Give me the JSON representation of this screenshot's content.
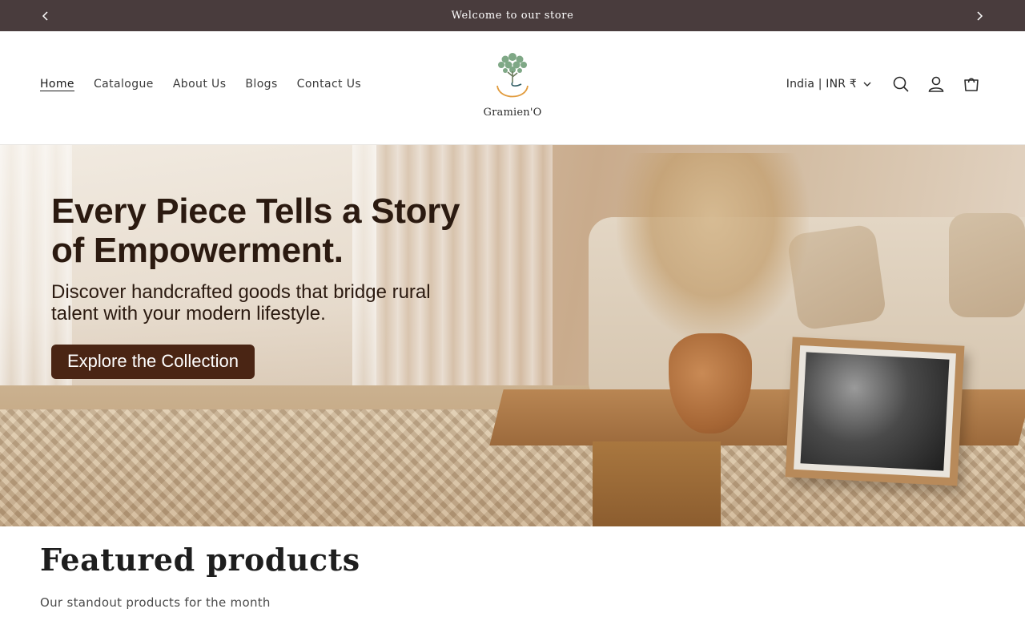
{
  "announcement": {
    "message": "Welcome to our store",
    "prev_icon": "chevron-left-icon",
    "next_icon": "chevron-right-icon"
  },
  "header": {
    "nav": [
      {
        "label": "Home",
        "active": true
      },
      {
        "label": "Catalogue",
        "active": false
      },
      {
        "label": "About Us",
        "active": false
      },
      {
        "label": "Blogs",
        "active": false
      },
      {
        "label": "Contact Us",
        "active": false
      }
    ],
    "logo": {
      "brand": "Gramien'O"
    },
    "country_selector": "India | INR ₹",
    "icons": [
      "search-icon",
      "account-icon",
      "cart-icon"
    ]
  },
  "hero": {
    "title": "Every Piece Tells a Story of Empowerment.",
    "subtitle": "Discover handcrafted goods that bridge rural talent with your modern lifestyle.",
    "cta": "Explore the Collection"
  },
  "featured": {
    "title": "Featured products",
    "subtitle": "Our standout products for the month"
  },
  "colors": {
    "announcement_bg": "#493c3d",
    "cta_bg": "#4a2514",
    "hero_text": "#2b1a10"
  }
}
